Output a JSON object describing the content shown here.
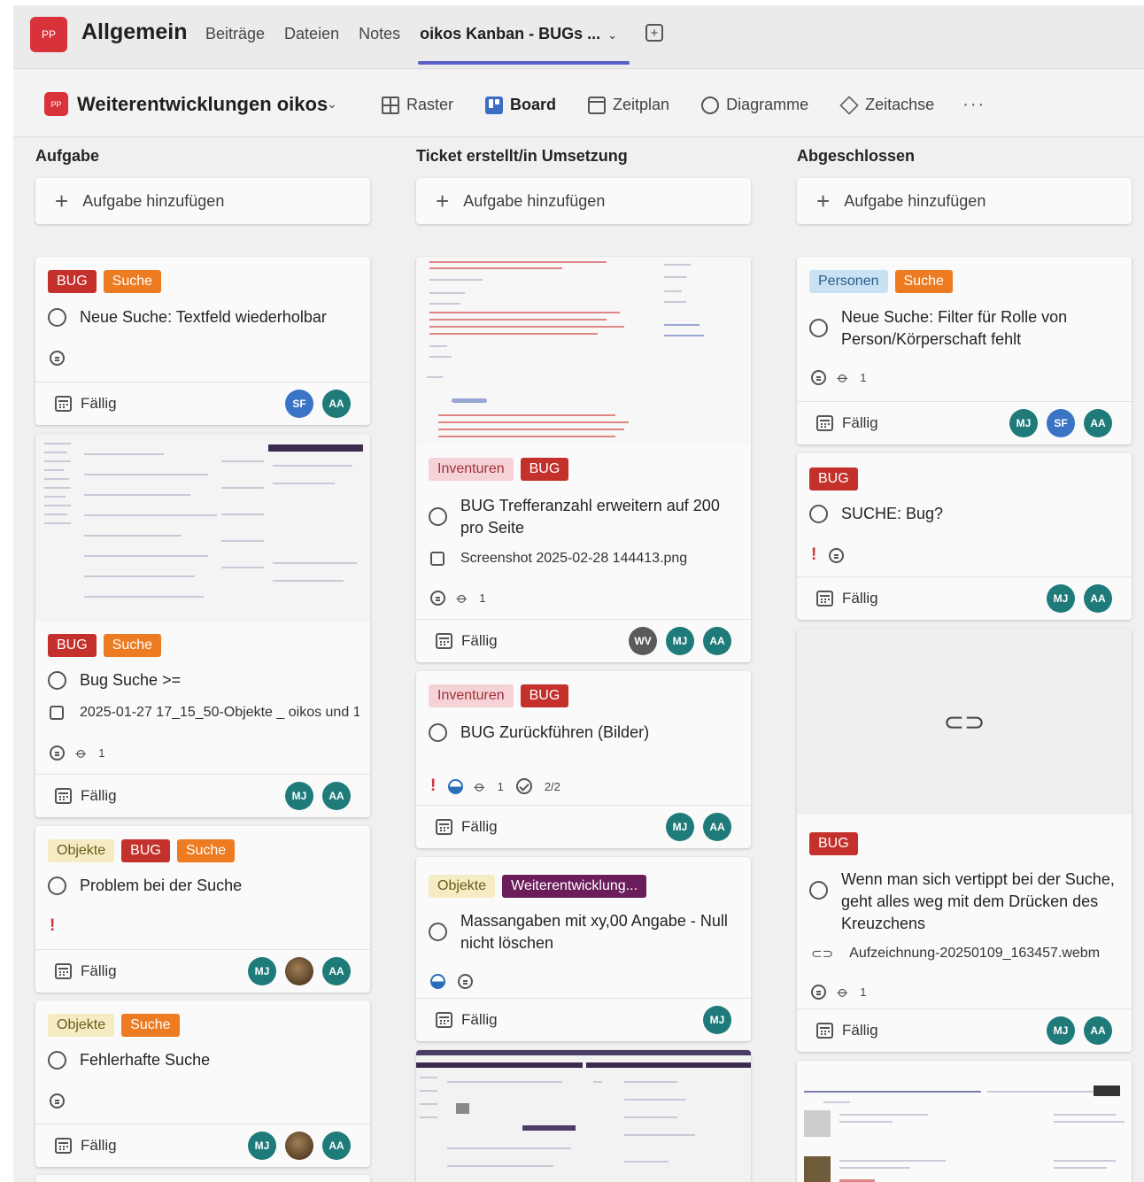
{
  "topbar": {
    "team_initials": "PP",
    "channel_name": "Allgemein",
    "tabs": [
      "Beiträge",
      "Dateien",
      "Notes",
      "oikos Kanban - BUGs ..."
    ],
    "active_tab_chevron": "⌄",
    "add_tab": "+"
  },
  "planner": {
    "plan_initials": "PP",
    "plan_name": "Weiterentwicklungen oikos",
    "views": [
      "Raster",
      "Board",
      "Zeitplan",
      "Diagramme",
      "Zeitachse"
    ],
    "more": "···"
  },
  "add_task_label": "Aufgabe hinzufügen",
  "due_label": "Fällig",
  "columns": [
    {
      "title": "Aufgabe",
      "cards": [
        {
          "labels": [
            "BUG",
            "Suche"
          ],
          "title": "Neue Suche: Textfeld wiederholbar",
          "avatars": [
            "SF",
            "AA"
          ]
        },
        {
          "labels": [
            "BUG",
            "Suche"
          ],
          "title": "Bug Suche >=",
          "attachment": "2025-01-27 17_15_50-Objekte _ oikos und 1",
          "attachments_count": "1",
          "avatars": [
            "MJ",
            "AA"
          ]
        },
        {
          "labels": [
            "Objekte",
            "BUG",
            "Suche"
          ],
          "title": "Problem bei der Suche",
          "avatars": [
            "MJ",
            "",
            "AA"
          ]
        },
        {
          "labels": [
            "Objekte",
            "Suche"
          ],
          "title": "Fehlerhafte Suche",
          "avatars": [
            "MJ",
            "",
            "AA"
          ]
        }
      ]
    },
    {
      "title": "Ticket erstellt/in Umsetzung",
      "cards": [
        {
          "labels": [
            "Inventuren",
            "BUG"
          ],
          "title": "BUG Trefferanzahl erweitern auf 200 pro Seite",
          "attachment": "Screenshot 2025-02-28 144413.png",
          "attachments_count": "1",
          "avatars": [
            "WV",
            "MJ",
            "AA"
          ]
        },
        {
          "labels": [
            "Inventuren",
            "BUG"
          ],
          "title": "BUG Zurückführen (Bilder)",
          "attachments_count": "1",
          "checklist": "2/2",
          "avatars": [
            "MJ",
            "AA"
          ]
        },
        {
          "labels": [
            "Objekte",
            "Weiterentwicklung..."
          ],
          "title": "Massangaben mit xy,00 Angabe - Null nicht löschen",
          "avatars": [
            "MJ"
          ]
        }
      ]
    },
    {
      "title": "Abgeschlossen",
      "cards": [
        {
          "labels": [
            "Personen",
            "Suche"
          ],
          "title": "Neue Suche: Filter für Rolle von Person/Körperschaft fehlt",
          "attachments_count": "1",
          "avatars": [
            "MJ",
            "SF",
            "AA"
          ]
        },
        {
          "labels": [
            "BUG"
          ],
          "title": "SUCHE: Bug?",
          "avatars": [
            "MJ",
            "AA"
          ]
        },
        {
          "labels": [
            "BUG"
          ],
          "title": "Wenn man sich vertippt bei der Suche, geht alles weg mit dem Drücken des Kreuzchens",
          "attachment": "Aufzeichnung-20250109_163457.webm",
          "attachments_count": "1",
          "avatars": [
            "MJ",
            "AA"
          ]
        }
      ]
    }
  ]
}
